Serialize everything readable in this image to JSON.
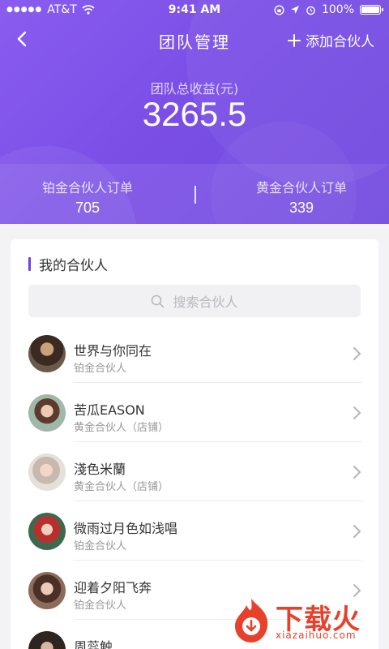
{
  "status_bar": {
    "carrier": "AT&T",
    "time": "9:41 AM",
    "battery": "100%",
    "battery_level": 1.0
  },
  "nav": {
    "title": "团队管理",
    "add_label": "添加合伙人"
  },
  "earnings": {
    "label": "团队总收益(元)",
    "value": "3265.5"
  },
  "stats": {
    "platinum_label": "铂金合伙人订单",
    "platinum_value": "705",
    "gold_label": "黄金合伙人订单",
    "gold_value": "339"
  },
  "partners": {
    "section_title": "我的合伙人",
    "search_placeholder": "搜索合伙人",
    "items": [
      {
        "name": "世界与你同在",
        "role": "铂金合伙人"
      },
      {
        "name": "苦瓜EASON",
        "role": "黄金合伙人（店铺）"
      },
      {
        "name": "淺色米蘭",
        "role": "黄金合伙人（店铺）"
      },
      {
        "name": "微雨过月色如浅唱",
        "role": "铂金合伙人"
      },
      {
        "name": "迎着夕阳飞奔",
        "role": "铂金合伙人"
      },
      {
        "name": "周蕊触",
        "role": ""
      }
    ]
  },
  "watermark": {
    "text": "下载火",
    "sub": "xiazaihuo.com"
  },
  "colors": {
    "header": "#7b4fe6",
    "accent": "#6a44e0",
    "watermark": "#e8412b"
  }
}
